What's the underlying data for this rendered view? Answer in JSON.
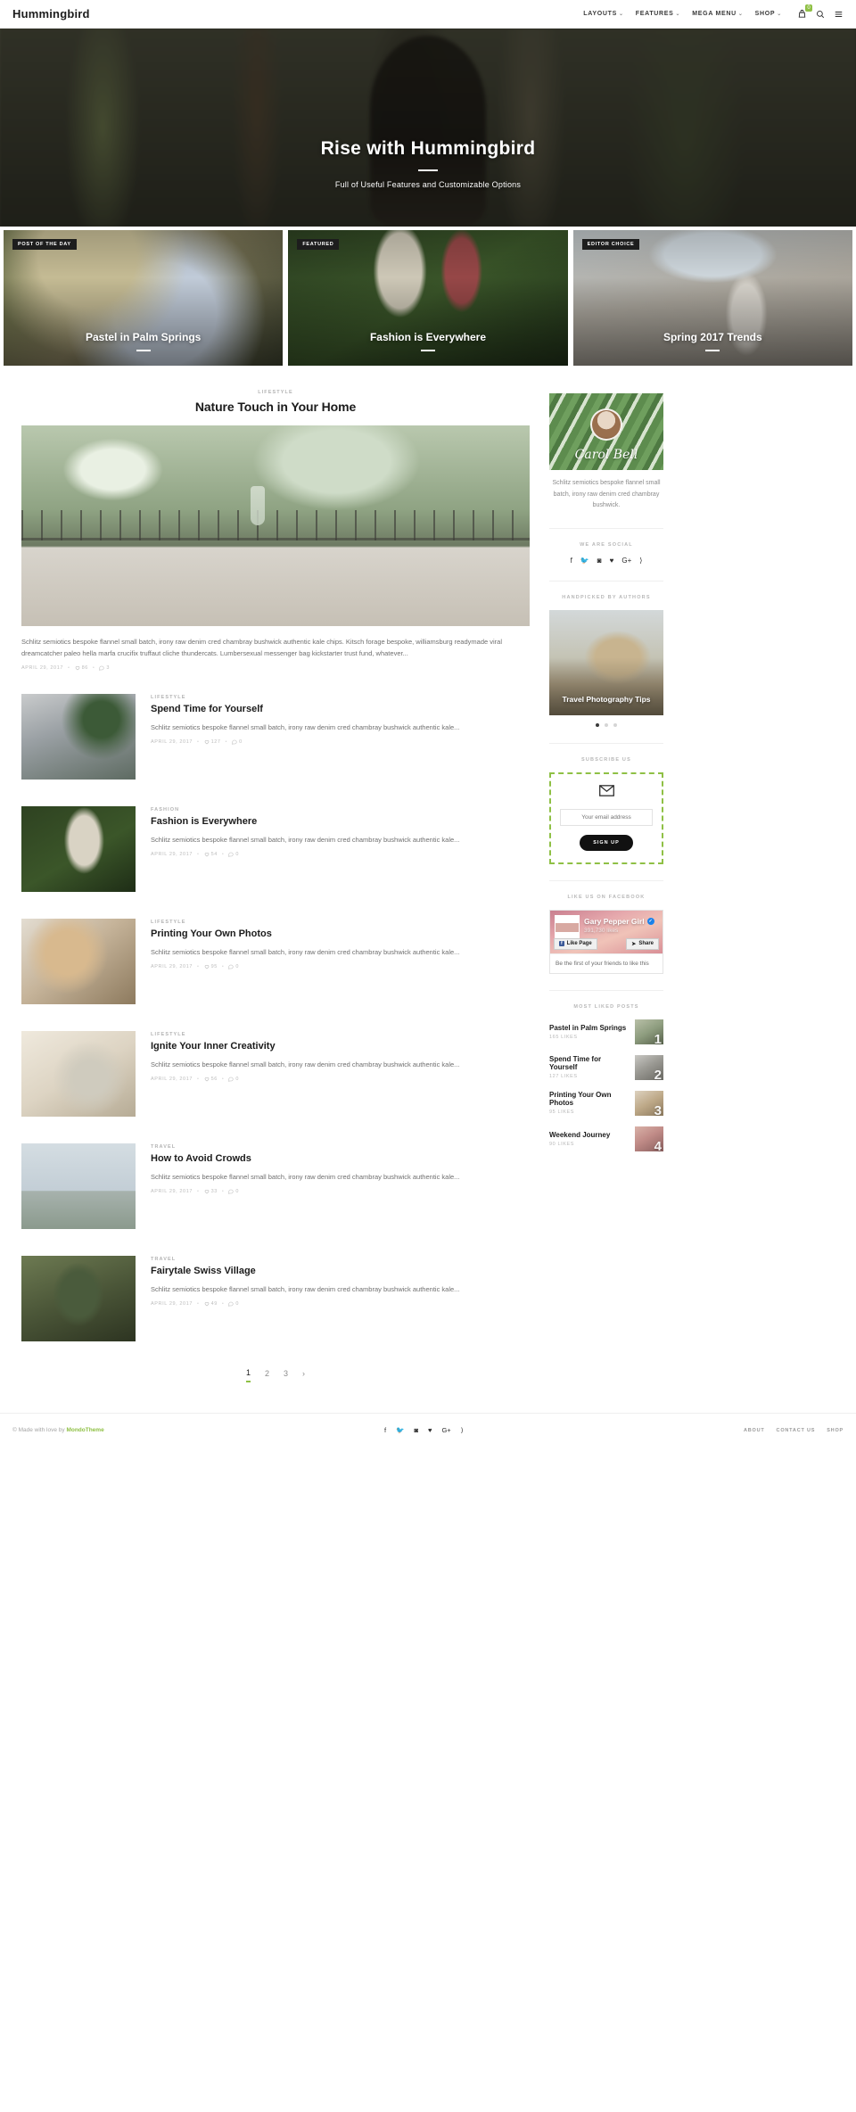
{
  "header": {
    "brand": "Hummingbird",
    "nav": [
      {
        "label": "LAYOUTS",
        "caret": "⌄"
      },
      {
        "label": "FEATURES",
        "caret": "⌄"
      },
      {
        "label": "MEGA MENU",
        "caret": "⌄"
      },
      {
        "label": "SHOP",
        "caret": "⌄"
      }
    ],
    "cart_count": "0",
    "search_icon": "search-icon",
    "menu_icon": "hamburger-icon"
  },
  "hero": {
    "title": "Rise with Hummingbird",
    "subtitle": "Full of Useful Features and Customizable Options"
  },
  "features": [
    {
      "badge": "POST OF THE DAY",
      "title": "Pastel in Palm Springs"
    },
    {
      "badge": "FEATURED",
      "title": "Fashion is Everywhere"
    },
    {
      "badge": "EDITOR CHOICE",
      "title": "Spring 2017 Trends"
    }
  ],
  "lead_post": {
    "category": "LIFESTYLE",
    "title": "Nature Touch in Your Home",
    "excerpt": "Schlitz semiotics bespoke flannel small batch, irony raw denim cred chambray bushwick authentic kale chips. Kitsch forage bespoke, williamsburg readymade viral dreamcatcher paleo hella marfa crucifix truffaut cliche thundercats. Lumbersexual messenger bag kickstarter trust fund, whatever...",
    "date": "APRIL 29, 2017",
    "likes": "86",
    "comments": "3"
  },
  "posts": [
    {
      "category": "LIFESTYLE",
      "title": "Spend Time for Yourself",
      "excerpt": "Schlitz semiotics bespoke flannel small batch, irony raw denim cred chambray bushwick authentic kale...",
      "date": "APRIL 29, 2017",
      "likes": "127",
      "comments": "0"
    },
    {
      "category": "FASHION",
      "title": "Fashion is Everywhere",
      "excerpt": "Schlitz semiotics bespoke flannel small batch, irony raw denim cred chambray bushwick authentic kale...",
      "date": "APRIL 29, 2017",
      "likes": "54",
      "comments": "0"
    },
    {
      "category": "LIFESTYLE",
      "title": "Printing Your Own Photos",
      "excerpt": "Schlitz semiotics bespoke flannel small batch, irony raw denim cred chambray bushwick authentic kale...",
      "date": "APRIL 29, 2017",
      "likes": "95",
      "comments": "0"
    },
    {
      "category": "LIFESTYLE",
      "title": "Ignite Your Inner Creativity",
      "excerpt": "Schlitz semiotics bespoke flannel small batch, irony raw denim cred chambray bushwick authentic kale...",
      "date": "APRIL 29, 2017",
      "likes": "56",
      "comments": "0"
    },
    {
      "category": "TRAVEL",
      "title": "How to Avoid Crowds",
      "excerpt": "Schlitz semiotics bespoke flannel small batch, irony raw denim cred chambray bushwick authentic kale...",
      "date": "APRIL 29, 2017",
      "likes": "33",
      "comments": "0"
    },
    {
      "category": "TRAVEL",
      "title": "Fairytale Swiss Village",
      "excerpt": "Schlitz semiotics bespoke flannel small batch, irony raw denim cred chambray bushwick authentic kale...",
      "date": "APRIL 29, 2017",
      "likes": "49",
      "comments": "0"
    }
  ],
  "pagination": {
    "pages": [
      "1",
      "2",
      "3"
    ],
    "active": "1",
    "next": "›"
  },
  "sidebar": {
    "about": {
      "signature": "Carol Bell",
      "text": "Schlitz semiotics bespoke flannel small batch, irony raw denim cred chambray bushwick."
    },
    "social": {
      "title": "WE ARE SOCIAL",
      "icons": [
        {
          "name": "facebook-icon",
          "glyph": "f"
        },
        {
          "name": "twitter-icon",
          "glyph": "🐦"
        },
        {
          "name": "instagram-icon",
          "glyph": "◙"
        },
        {
          "name": "bloglovin-icon",
          "glyph": "♥"
        },
        {
          "name": "google-plus-icon",
          "glyph": "G+"
        },
        {
          "name": "rss-icon",
          "glyph": "⟩"
        }
      ]
    },
    "handpicked": {
      "title": "HANDPICKED BY AUTHORS",
      "slide_title": "Travel Photography Tips",
      "dots": 3,
      "active_dot": 0
    },
    "subscribe": {
      "title": "SUBSCRIBE US",
      "placeholder": "Your email address",
      "value": "",
      "button": "SIGN UP"
    },
    "facebook": {
      "title": "LIKE US ON FACEBOOK",
      "page_name": "Gary Pepper Girl",
      "likes": "391,730 likes",
      "like_button": "Like Page",
      "share_button": "Share",
      "footer_text": "Be the first of your friends to like this"
    },
    "most_liked": {
      "title": "MOST LIKED POSTS",
      "items": [
        {
          "title": "Pastel in Palm Springs",
          "likes": "165 LIKES",
          "rank": "1"
        },
        {
          "title": "Spend Time for Yourself",
          "likes": "127 LIKES",
          "rank": "2"
        },
        {
          "title": "Printing Your Own Photos",
          "likes": "95 LIKES",
          "rank": "3"
        },
        {
          "title": "Weekend Journey",
          "likes": "90 LIKES",
          "rank": "4"
        }
      ]
    }
  },
  "footer": {
    "copyright_prefix": "© Made with love by ",
    "copyright_brand": "MondoTheme",
    "social": [
      "f",
      "🐦",
      "◙",
      "♥",
      "G+",
      "⟩"
    ],
    "links": [
      "ABOUT",
      "CONTACT US",
      "SHOP"
    ]
  },
  "colors": {
    "accent": "#8fc045",
    "text": "#1b1b1b",
    "muted": "#b8b8b8"
  }
}
